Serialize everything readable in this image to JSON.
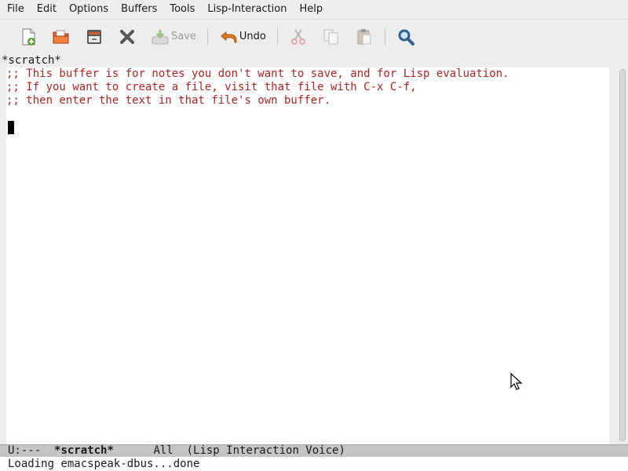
{
  "menubar": {
    "items": [
      "File",
      "Edit",
      "Options",
      "Buffers",
      "Tools",
      "Lisp-Interaction",
      "Help"
    ]
  },
  "toolbar": {
    "buttons": [
      {
        "icon": "new-file-icon",
        "label": ""
      },
      {
        "icon": "open-folder-icon",
        "label": ""
      },
      {
        "icon": "dired-cabinet-icon",
        "label": ""
      },
      {
        "icon": "close-x-icon",
        "label": ""
      },
      {
        "icon": "save-icon",
        "label": "Save",
        "enabled": false
      },
      {
        "icon": "undo-arrow-icon",
        "label": "Undo",
        "enabled": true
      },
      {
        "icon": "cut-scissors-icon",
        "label": "",
        "enabled": false
      },
      {
        "icon": "copy-icon",
        "label": "",
        "enabled": false
      },
      {
        "icon": "paste-icon",
        "label": "",
        "enabled": false
      },
      {
        "icon": "search-magnifier-icon",
        "label": ""
      }
    ]
  },
  "buffer": {
    "header": "*scratch*",
    "lines": [
      ";; This buffer is for notes you don't want to save, and for Lisp evaluation.",
      ";; If you want to create a file, visit that file with C-x C-f,",
      ";; then enter the text in that file's own buffer."
    ]
  },
  "modeline": {
    "status": "U:---  ",
    "buffer_name": "*scratch*",
    "position": "      All  ",
    "mode": "(Lisp Interaction Voice)"
  },
  "echo": {
    "message": "Loading emacspeak-dbus...done"
  },
  "colors": {
    "comment": "#b22222",
    "chrome": "#ededed",
    "modeline": "#c4c4c4"
  }
}
